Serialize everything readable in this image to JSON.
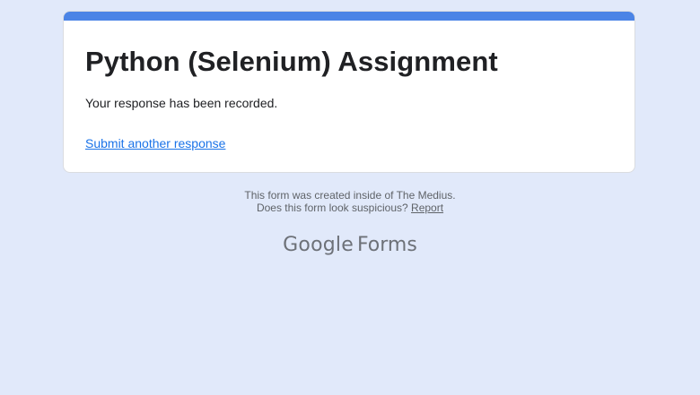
{
  "form": {
    "title": "Python (Selenium) Assignment",
    "confirmation_message": "Your response has been recorded.",
    "submit_another_label": "Submit another response"
  },
  "footer": {
    "created_inside": "This form was created inside of The Medius.",
    "suspicious_prompt": "Does this form look suspicious?",
    "report_label": "Report"
  },
  "branding": {
    "logo_google": "Google",
    "logo_forms": "Forms"
  },
  "colors": {
    "background": "#e1e9fa",
    "accent_bar": "#4b84e6",
    "link": "#1a73e8"
  }
}
